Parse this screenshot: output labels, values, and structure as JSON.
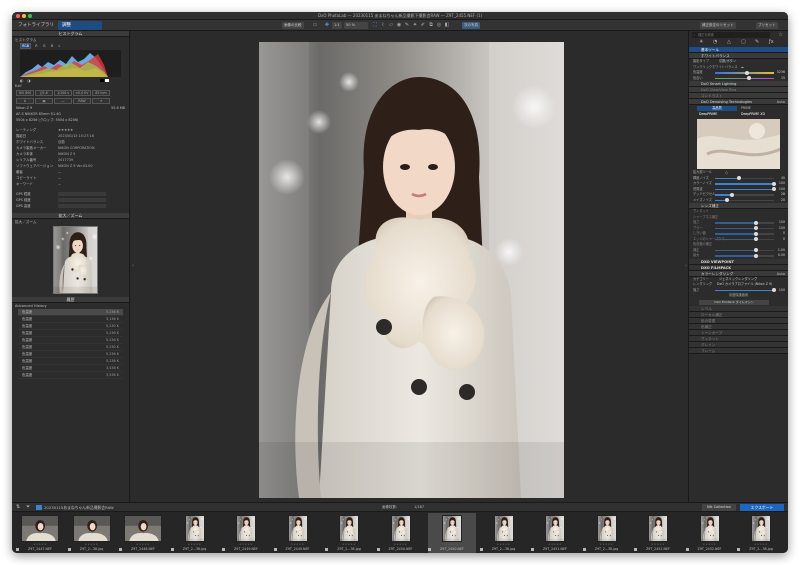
{
  "window": {
    "title": "DxO PhotoLab — 20230115 あまねちゃん新品撮影下撮影会RAW — Z9T_2455.NEF (1)"
  },
  "tabs": {
    "library": "フォトライブラリ",
    "customize": "調整"
  },
  "toolbar": {
    "compare": "画像の比較",
    "zoom_fit": "1:1",
    "zoom": "50 %",
    "export_disk": "次の写真",
    "reset": "補正設定のリセット",
    "preset": "プリセット"
  },
  "histogram": {
    "header": "ヒストグラム",
    "title": "ヒストグラム",
    "channels": [
      "RGB",
      "R",
      "G",
      "B",
      "L"
    ]
  },
  "exif": {
    "title": "Exif",
    "row1": [
      "ISO 800",
      "ƒ/2.8",
      "1/100 s",
      "±0.0 EV",
      "85 mm"
    ],
    "row2": [
      "A",
      "",
      "—",
      "RAW",
      ""
    ],
    "camera": "Nikon Z 9",
    "size": "55.6 MB",
    "lens": "AF-S NIKKOR 85mm f/1.4G",
    "dims": "5504 x 8256 (クロップ: 5504 x 8256)"
  },
  "meta": {
    "rows": [
      {
        "label": "レーティング",
        "value": "★★★★★"
      },
      {
        "label": "撮影日",
        "value": "2023/01/15 15:27:16"
      },
      {
        "label": "ホワイトバランス",
        "value": "自動"
      },
      {
        "label": "カメラ製造メーカー",
        "value": "NIKON CORPORATION"
      },
      {
        "label": "カメラ本体",
        "value": "NIKON Z 9"
      },
      {
        "label": "シリアル番号",
        "value": "2017739"
      },
      {
        "label": "ソフトウェアバージョン",
        "value": "NIKON Z 9 Ver.03.00"
      },
      {
        "label": "著者",
        "value": "—"
      },
      {
        "label": "コピーライト",
        "value": "—"
      },
      {
        "label": "キーワード",
        "value": "—"
      }
    ],
    "gps": [
      "GPS 緯度",
      "GPS 経度",
      "GPS 高度"
    ]
  },
  "loupe": {
    "header": "拡大／ズーム",
    "title": "拡大／ズーム"
  },
  "history": {
    "header": "履歴",
    "title": "Advanced History",
    "items": [
      {
        "label": "色温度",
        "value": "5,236 K",
        "sel": true
      },
      {
        "label": "色温度",
        "value": "3,136 K"
      },
      {
        "label": "色温度",
        "value": "5,230 K"
      },
      {
        "label": "色温度",
        "value": "5,236 K"
      },
      {
        "label": "色温度",
        "value": "5,236 K"
      },
      {
        "label": "色温度",
        "value": "5,230 K"
      },
      {
        "label": "色温度",
        "value": "5,236 K"
      },
      {
        "label": "色温度",
        "value": "5,236 K"
      },
      {
        "label": "色温度",
        "value": "3,536 K"
      },
      {
        "label": "色温度",
        "value": "3,536 K"
      }
    ]
  },
  "bottombar": {
    "path": "20230115あまねちゃん新品撮影会RAW",
    "count": "画像枚数：",
    "index": "1/187",
    "nik": "Nik Collection",
    "export": "エクスポート"
  },
  "right": {
    "search": "補正を検索",
    "essential": "基本ツール",
    "wb": {
      "title": "ホワイトバランス",
      "mode_label": "撮影タイプ",
      "mode": "引数/ボタン",
      "picker": "ワンクリックホワイトバランス",
      "temp_label": "色温度",
      "temp": "5236",
      "tint_label": "色合い",
      "tint": "15"
    },
    "smart": "DxO Smart Lighting",
    "selective": "DxO ClearView Plus",
    "contrast": "コントラスト",
    "denoise": {
      "title": "DxO Denoising Technologies",
      "value": "Auto",
      "hq": "高品質",
      "prime": "PRIME",
      "dp": "DeepPRIME",
      "dpxd": "DeepPRIME XD",
      "zoom_tool": "拡大鏡ツール",
      "rows": [
        {
          "label": "輝度ノイズ",
          "value": "40",
          "pct": 0.4
        },
        {
          "label": "カラーノイズ",
          "value": "100",
          "pct": 1
        },
        {
          "label": "低周波",
          "value": "100",
          "pct": 1
        },
        {
          "label": "デッドピクセル",
          "value": "28",
          "pct": 0.28
        },
        {
          "label": "メイズノイズ",
          "value": "20",
          "pct": 0.2
        }
      ]
    },
    "lens": {
      "title": "レンズ補正",
      "rows": [
        "ヴィネット",
        "シャープネス補正",
        "強さ",
        "ブラー",
        "しきい値",
        "エッジのシャープネス",
        "色収差の補正",
        "補正",
        "最大"
      ],
      "values": [
        "100",
        "100",
        "0",
        "0",
        "1.00",
        "0.00"
      ]
    },
    "viewpoint": "DXO VIEWPOINT",
    "filmpack": "DXO FILMPACK",
    "colorrender": {
      "title": "カラーレンダリング",
      "value": "Auto",
      "cat_label": "カテゴリー",
      "cat": "ジェネリックレンダリング",
      "rend_label": "レンダリング",
      "rend": "DxO カメラプロファイル (Nikon Z 9)",
      "int_label": "強さ",
      "int": "100",
      "protect": "彩度保護適用",
      "tools": "DxO FilmPack タイムマシン"
    },
    "more": [
      "レベル",
      "ローカル補正",
      "色の変更",
      "色補正",
      "トーンカーブ",
      "ヴィネット",
      "グレイン",
      "フレーム"
    ]
  },
  "filmstrip": [
    {
      "name": "Z9T_2447.NEF",
      "type": "land"
    },
    {
      "name": "Z9T_2...38.jpg",
      "type": "land"
    },
    {
      "name": "Z9T_2448.NEF",
      "type": "land"
    },
    {
      "name": "Z9T_2...38.jpg",
      "type": "port"
    },
    {
      "name": "Z9T_2449.NEF",
      "type": "port"
    },
    {
      "name": "Z9T_2449.NEF",
      "type": "port"
    },
    {
      "name": "Z9T_2...38.jpg",
      "type": "port"
    },
    {
      "name": "Z9T_2450.NEF",
      "type": "port"
    },
    {
      "name": "Z9T_2450.NEF",
      "type": "port",
      "sel": true
    },
    {
      "name": "Z9T_2...38.jpg",
      "type": "port"
    },
    {
      "name": "Z9T_2451.NEF",
      "type": "port"
    },
    {
      "name": "Z9T_2...38.jpg",
      "type": "port"
    },
    {
      "name": "Z9T_2452.NEF",
      "type": "port"
    },
    {
      "name": "Z9T_2452.NEF",
      "type": "port"
    },
    {
      "name": "Z9T_2...38.jpg",
      "type": "port"
    }
  ]
}
